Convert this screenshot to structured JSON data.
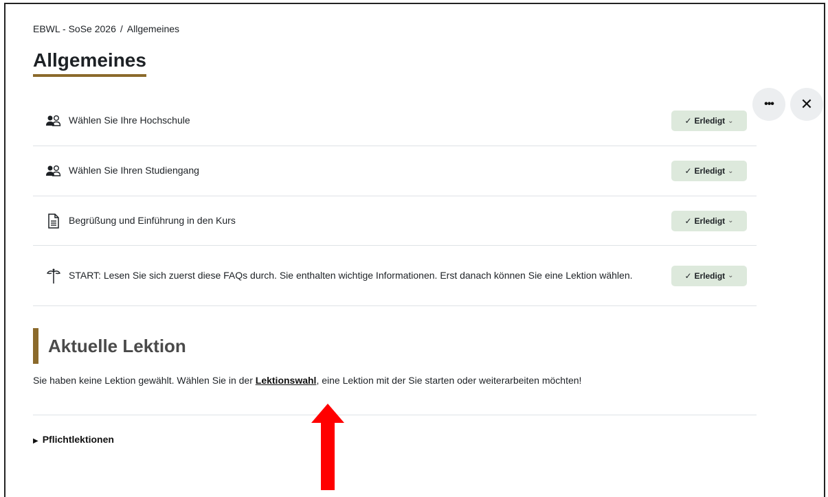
{
  "breadcrumb": {
    "course": "EBWL - SoSe 2026",
    "separator": "/",
    "current": "Allgemeines"
  },
  "page_title": "Allgemeines",
  "header_actions": {
    "more_icon": "more-horizontal-icon",
    "more_glyph": "•••",
    "close_icon": "close-icon",
    "close_glyph": "✕"
  },
  "activities": [
    {
      "icon": "users-icon",
      "label": "Wählen Sie Ihre Hochschule",
      "status": "Erledigt"
    },
    {
      "icon": "users-icon",
      "label": "Wählen Sie Ihren Studiengang",
      "status": "Erledigt"
    },
    {
      "icon": "document-icon",
      "label": "Begrüßung und Einführung in den Kurs",
      "status": "Erledigt"
    },
    {
      "icon": "signpost-icon",
      "label": "START: Lesen Sie sich zuerst diese FAQs durch. Sie enthalten wichtige Informationen. Erst danach können Sie eine Lektion wählen.",
      "status": "Erledigt"
    }
  ],
  "current_lesson": {
    "title": "Aktuelle Lektion",
    "text_before": "Sie haben keine Lektion gewählt. Wählen Sie in der ",
    "link": "Lektionswahl",
    "text_after": ", eine Lektion mit der Sie starten oder weiterarbeiten möchten!"
  },
  "collapsible": {
    "label": "Pflichtlektionen"
  },
  "colors": {
    "accent": "#8b6a2b",
    "done_bg": "#dde9dc",
    "annotation_arrow": "#ff0000"
  }
}
